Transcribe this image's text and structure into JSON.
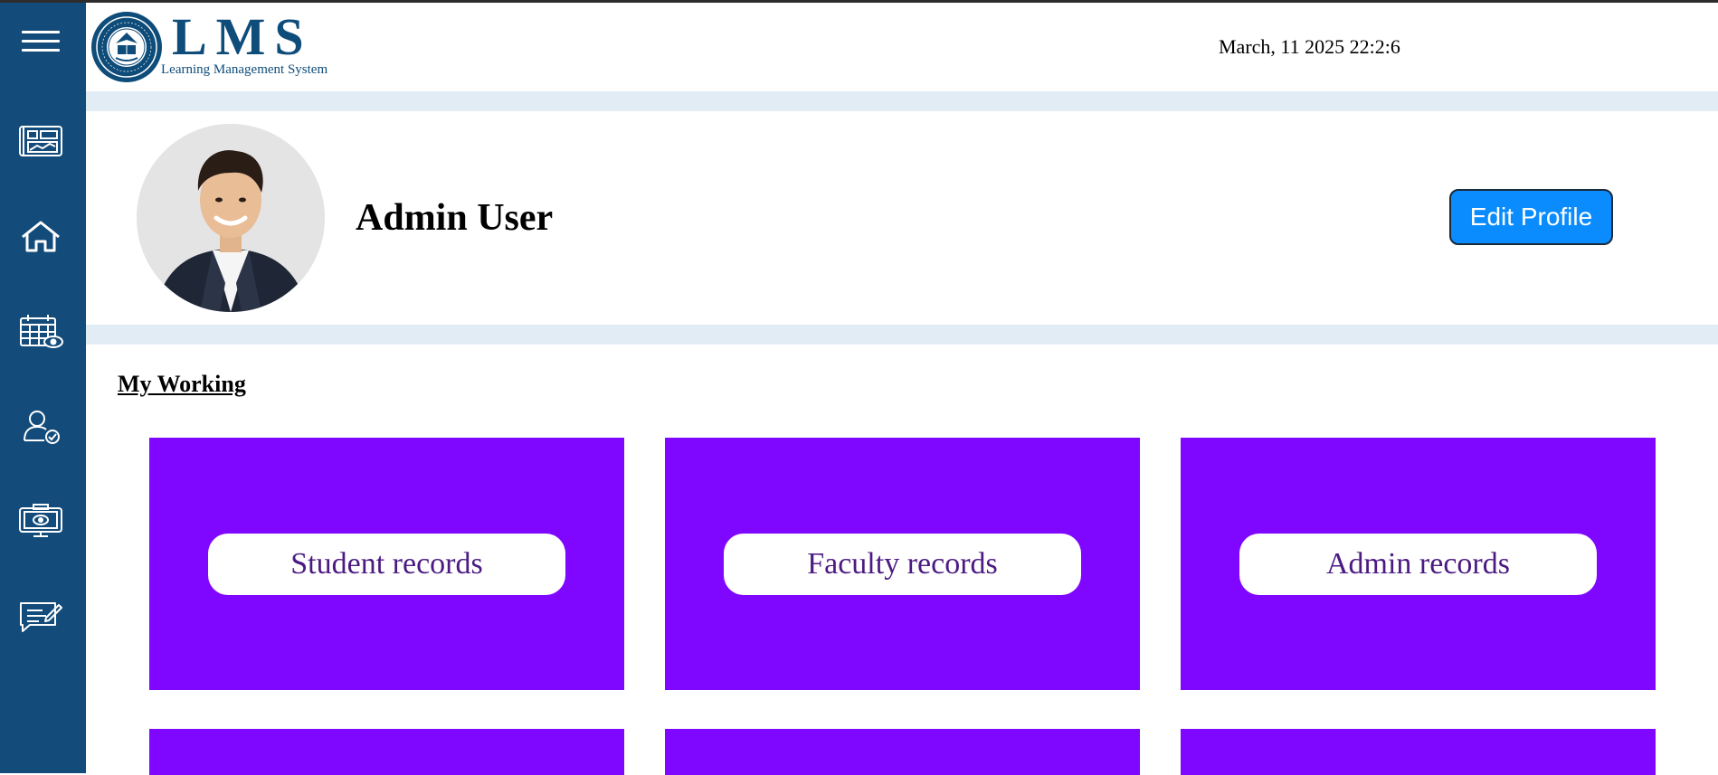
{
  "app": {
    "logo_text": "LMS",
    "logo_subtitle": "Learning Management System",
    "datetime": "March, 11 2025 22:2:6"
  },
  "sidebar": {
    "items": [
      {
        "icon": "menu-icon"
      },
      {
        "icon": "dashboard-icon"
      },
      {
        "icon": "home-icon"
      },
      {
        "icon": "calendar-view-icon"
      },
      {
        "icon": "user-check-icon"
      },
      {
        "icon": "screen-view-icon"
      },
      {
        "icon": "feedback-icon"
      }
    ]
  },
  "profile": {
    "name": "Admin User",
    "edit_button": "Edit Profile"
  },
  "section": {
    "title": "My Working"
  },
  "cards": [
    {
      "label": "Student records"
    },
    {
      "label": "Faculty records"
    },
    {
      "label": "Admin records"
    }
  ],
  "colors": {
    "sidebar": "#134b7a",
    "card": "#7f07ff",
    "button": "#0a8cff",
    "band": "#e2ecf5",
    "brand": "#0e4c7a"
  }
}
